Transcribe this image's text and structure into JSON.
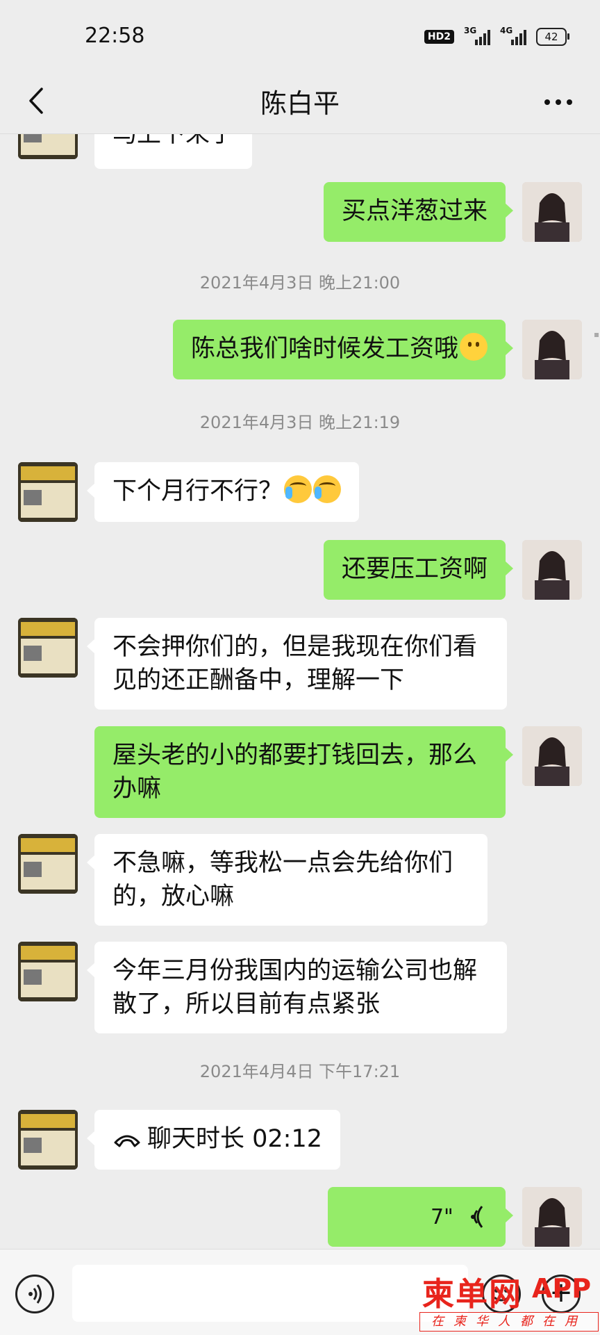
{
  "status_bar": {
    "time": "22:58",
    "hd_label": "HD2",
    "network_1": "3G",
    "network_2": "4G",
    "battery": "42"
  },
  "nav": {
    "title": "陈白平"
  },
  "messages": [
    {
      "side": "left",
      "text": "马上下来了",
      "partial": true
    },
    {
      "side": "right",
      "text": "买点洋葱过来"
    },
    {
      "type": "timestamp",
      "text": "2021年4月3日 晚上21:00"
    },
    {
      "side": "right",
      "text": "陈总我们啥时候发工资哦",
      "emoji": "smile-emoji"
    },
    {
      "type": "timestamp",
      "text": "2021年4月3日 晚上21:19"
    },
    {
      "side": "left",
      "text": "下个月行不行？",
      "emoji": "crying-emoji"
    },
    {
      "side": "right",
      "text": "还要压工资啊"
    },
    {
      "side": "left",
      "lines": [
        "不会押你们的，但是我现在你们看",
        "见的还正酬备中，理解一下"
      ]
    },
    {
      "side": "right",
      "lines": [
        "屋头老的小的都要打钱回去，那么",
        "办嘛"
      ]
    },
    {
      "side": "left",
      "lines": [
        "不急嘛，等我松一点会先给你们",
        "的，放心嘛"
      ]
    },
    {
      "side": "left",
      "lines": [
        "今年三月份我国内的运输公司也解",
        "散了，所以目前有点紧张"
      ]
    },
    {
      "type": "timestamp",
      "text": "2021年4月4日 下午17:21"
    },
    {
      "side": "left",
      "type": "call",
      "text": "聊天时长 02:12"
    },
    {
      "side": "right",
      "type": "voice",
      "duration": "7\""
    }
  ],
  "watermark": {
    "brand": "柬单网",
    "app": "APP",
    "slogan": "在柬华人都在用"
  },
  "colors": {
    "background": "#ededed",
    "bubble_green": "#95ec69",
    "bubble_white": "#ffffff",
    "watermark_red": "#e8241c"
  }
}
